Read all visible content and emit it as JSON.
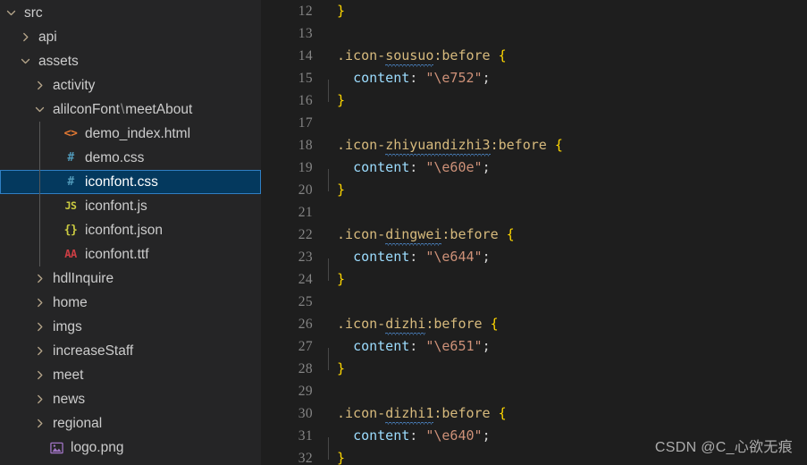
{
  "app": {
    "theme": "Dark+ (default dark)",
    "colors": {
      "sidebar_background": "#252526",
      "editor_background": "#1e1e1e",
      "selected_row_background": "#04395e",
      "selected_row_border": "#2f7fc4",
      "line_number": "#858585",
      "selector": "#d7ba7d",
      "property": "#9cdcfe",
      "string": "#ce9178",
      "brace": "#ffd700",
      "squiggle": "#4f8fd4"
    }
  },
  "sidebar": {
    "name": "explorer-file-tree",
    "items": [
      {
        "label": "src",
        "indent": 0,
        "kind": "folder",
        "expanded": true,
        "twisty": "chevron-down-icon",
        "icon": "",
        "selected": false
      },
      {
        "label": "api",
        "indent": 1,
        "kind": "folder",
        "expanded": false,
        "twisty": "chevron-right-icon",
        "icon": "",
        "selected": false
      },
      {
        "label": "assets",
        "indent": 1,
        "kind": "folder",
        "expanded": true,
        "twisty": "chevron-down-icon",
        "icon": "",
        "selected": false
      },
      {
        "label": "activity",
        "indent": 2,
        "kind": "folder",
        "expanded": false,
        "twisty": "chevron-right-icon",
        "icon": "",
        "selected": false
      },
      {
        "label": "alilconFont\\meetAbout",
        "indent": 2,
        "kind": "folder",
        "expanded": true,
        "twisty": "chevron-down-icon",
        "icon": "",
        "selected": false,
        "split": [
          "alilconFont",
          "\\",
          "meetAbout"
        ]
      },
      {
        "label": "demo_index.html",
        "indent": 3,
        "kind": "file",
        "twisty": "",
        "icon": "html-file-icon",
        "glyph": "<>",
        "selected": false
      },
      {
        "label": "demo.css",
        "indent": 3,
        "kind": "file",
        "twisty": "",
        "icon": "css-file-icon",
        "glyph": "#",
        "selected": false
      },
      {
        "label": "iconfont.css",
        "indent": 3,
        "kind": "file",
        "twisty": "",
        "icon": "css-file-icon",
        "glyph": "#",
        "selected": true
      },
      {
        "label": "iconfont.js",
        "indent": 3,
        "kind": "file",
        "twisty": "",
        "icon": "js-file-icon",
        "glyph": "JS",
        "selected": false
      },
      {
        "label": "iconfont.json",
        "indent": 3,
        "kind": "file",
        "twisty": "",
        "icon": "json-file-icon",
        "glyph": "{}",
        "selected": false
      },
      {
        "label": "iconfont.ttf",
        "indent": 3,
        "kind": "file",
        "twisty": "",
        "icon": "font-file-icon",
        "glyph": "AA",
        "selected": false
      },
      {
        "label": "hdlInquire",
        "indent": 2,
        "kind": "folder",
        "expanded": false,
        "twisty": "chevron-right-icon",
        "icon": "",
        "selected": false
      },
      {
        "label": "home",
        "indent": 2,
        "kind": "folder",
        "expanded": false,
        "twisty": "chevron-right-icon",
        "icon": "",
        "selected": false
      },
      {
        "label": "imgs",
        "indent": 2,
        "kind": "folder",
        "expanded": false,
        "twisty": "chevron-right-icon",
        "icon": "",
        "selected": false
      },
      {
        "label": "increaseStaff",
        "indent": 2,
        "kind": "folder",
        "expanded": false,
        "twisty": "chevron-right-icon",
        "icon": "",
        "selected": false
      },
      {
        "label": "meet",
        "indent": 2,
        "kind": "folder",
        "expanded": false,
        "twisty": "chevron-right-icon",
        "icon": "",
        "selected": false
      },
      {
        "label": "news",
        "indent": 2,
        "kind": "folder",
        "expanded": false,
        "twisty": "chevron-right-icon",
        "icon": "",
        "selected": false
      },
      {
        "label": "regional",
        "indent": 2,
        "kind": "folder",
        "expanded": false,
        "twisty": "chevron-right-icon",
        "icon": "",
        "selected": false
      },
      {
        "label": "logo.png",
        "indent": 2,
        "kind": "file",
        "twisty": "",
        "icon": "image-file-icon",
        "glyph": "▧",
        "selected": false
      }
    ]
  },
  "editor": {
    "name": "code-editor",
    "language": "css",
    "first_line_number": 12,
    "lines": [
      {
        "n": 12,
        "indent": false,
        "tokens": [
          {
            "t": "}",
            "c": "brace"
          }
        ]
      },
      {
        "n": 13,
        "indent": false,
        "tokens": []
      },
      {
        "n": 14,
        "indent": false,
        "tokens": [
          {
            "t": ".icon-",
            "c": "sel"
          },
          {
            "t": "sousuo",
            "c": "sel",
            "squiggle": true
          },
          {
            "t": ":before",
            "c": "pseudo"
          },
          {
            "t": " ",
            "c": "punct"
          },
          {
            "t": "{",
            "c": "brace"
          }
        ]
      },
      {
        "n": 15,
        "indent": true,
        "tokens": [
          {
            "t": "  ",
            "c": "punct"
          },
          {
            "t": "content",
            "c": "prop"
          },
          {
            "t": ": ",
            "c": "punct"
          },
          {
            "t": "\"\\e752\"",
            "c": "str"
          },
          {
            "t": ";",
            "c": "punct"
          }
        ]
      },
      {
        "n": 16,
        "indent": false,
        "tokens": [
          {
            "t": "}",
            "c": "brace"
          }
        ]
      },
      {
        "n": 17,
        "indent": false,
        "tokens": []
      },
      {
        "n": 18,
        "indent": false,
        "tokens": [
          {
            "t": ".icon-",
            "c": "sel"
          },
          {
            "t": "zhiyuandizhi3",
            "c": "sel",
            "squiggle": true
          },
          {
            "t": ":before",
            "c": "pseudo"
          },
          {
            "t": " ",
            "c": "punct"
          },
          {
            "t": "{",
            "c": "brace"
          }
        ]
      },
      {
        "n": 19,
        "indent": true,
        "tokens": [
          {
            "t": "  ",
            "c": "punct"
          },
          {
            "t": "content",
            "c": "prop"
          },
          {
            "t": ": ",
            "c": "punct"
          },
          {
            "t": "\"\\e60e\"",
            "c": "str"
          },
          {
            "t": ";",
            "c": "punct"
          }
        ]
      },
      {
        "n": 20,
        "indent": false,
        "tokens": [
          {
            "t": "}",
            "c": "brace"
          }
        ]
      },
      {
        "n": 21,
        "indent": false,
        "tokens": []
      },
      {
        "n": 22,
        "indent": false,
        "tokens": [
          {
            "t": ".icon-",
            "c": "sel"
          },
          {
            "t": "dingwei",
            "c": "sel",
            "squiggle": true
          },
          {
            "t": ":before",
            "c": "pseudo"
          },
          {
            "t": " ",
            "c": "punct"
          },
          {
            "t": "{",
            "c": "brace"
          }
        ]
      },
      {
        "n": 23,
        "indent": true,
        "tokens": [
          {
            "t": "  ",
            "c": "punct"
          },
          {
            "t": "content",
            "c": "prop"
          },
          {
            "t": ": ",
            "c": "punct"
          },
          {
            "t": "\"\\e644\"",
            "c": "str"
          },
          {
            "t": ";",
            "c": "punct"
          }
        ]
      },
      {
        "n": 24,
        "indent": false,
        "tokens": [
          {
            "t": "}",
            "c": "brace"
          }
        ]
      },
      {
        "n": 25,
        "indent": false,
        "tokens": []
      },
      {
        "n": 26,
        "indent": false,
        "tokens": [
          {
            "t": ".icon-",
            "c": "sel"
          },
          {
            "t": "dizhi",
            "c": "sel",
            "squiggle": true
          },
          {
            "t": ":before",
            "c": "pseudo"
          },
          {
            "t": " ",
            "c": "punct"
          },
          {
            "t": "{",
            "c": "brace"
          }
        ]
      },
      {
        "n": 27,
        "indent": true,
        "tokens": [
          {
            "t": "  ",
            "c": "punct"
          },
          {
            "t": "content",
            "c": "prop"
          },
          {
            "t": ": ",
            "c": "punct"
          },
          {
            "t": "\"\\e651\"",
            "c": "str"
          },
          {
            "t": ";",
            "c": "punct"
          }
        ]
      },
      {
        "n": 28,
        "indent": false,
        "tokens": [
          {
            "t": "}",
            "c": "brace"
          }
        ]
      },
      {
        "n": 29,
        "indent": false,
        "tokens": []
      },
      {
        "n": 30,
        "indent": false,
        "tokens": [
          {
            "t": ".icon-",
            "c": "sel"
          },
          {
            "t": "dizhi1",
            "c": "sel",
            "squiggle": true
          },
          {
            "t": ":before",
            "c": "pseudo"
          },
          {
            "t": " ",
            "c": "punct"
          },
          {
            "t": "{",
            "c": "brace"
          }
        ]
      },
      {
        "n": 31,
        "indent": true,
        "tokens": [
          {
            "t": "  ",
            "c": "punct"
          },
          {
            "t": "content",
            "c": "prop"
          },
          {
            "t": ": ",
            "c": "punct"
          },
          {
            "t": "\"\\e640\"",
            "c": "str"
          },
          {
            "t": ";",
            "c": "punct"
          }
        ]
      },
      {
        "n": 32,
        "indent": false,
        "tokens": [
          {
            "t": "}",
            "c": "brace"
          }
        ]
      }
    ]
  },
  "watermark": {
    "text": "CSDN @C_心欲无痕"
  }
}
